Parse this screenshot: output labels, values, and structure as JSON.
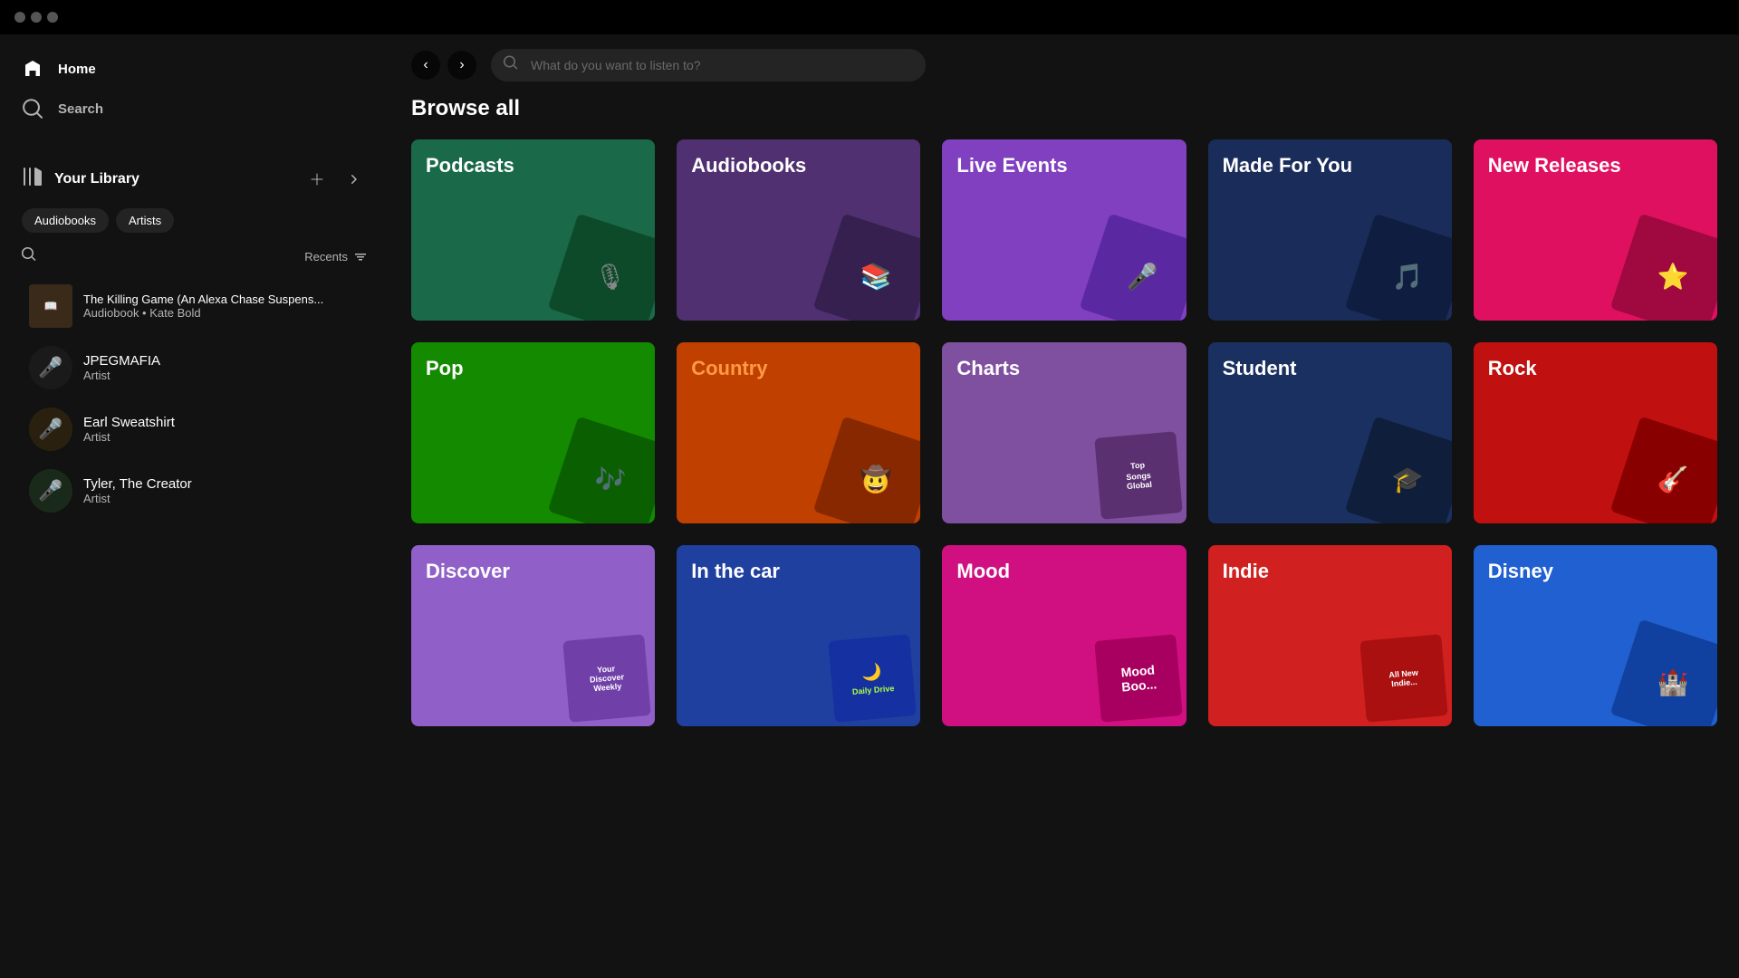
{
  "titlebar": {
    "dots": [
      "",
      "",
      ""
    ]
  },
  "sidebar": {
    "nav": [
      {
        "id": "home",
        "label": "Home",
        "icon": "⌂"
      },
      {
        "id": "search",
        "label": "Search",
        "icon": "⌕"
      }
    ],
    "library": {
      "title": "Your Library",
      "add_label": "+",
      "expand_label": "→",
      "filters": [
        "Audiobooks",
        "Artists"
      ],
      "recents_label": "Recents",
      "items": [
        {
          "id": "killing-game",
          "name": "The Killing Game (An Alexa Chase Suspens...",
          "sub": "Audiobook • Kate Bold",
          "type": "book",
          "bg": "#3a2a1a",
          "emoji": "📚"
        },
        {
          "id": "jpegmafia",
          "name": "JPEGMAFIA",
          "sub": "Artist",
          "type": "artist",
          "bg": "#2a2a2a",
          "emoji": "🎤",
          "round": true
        },
        {
          "id": "earl-sweatshirt",
          "name": "Earl Sweatshirt",
          "sub": "Artist",
          "type": "artist",
          "bg": "#2a2a2a",
          "emoji": "🎤",
          "round": true
        },
        {
          "id": "tyler-the-creator",
          "name": "Tyler, The Creator",
          "sub": "Artist",
          "type": "artist",
          "bg": "#2a2a2a",
          "emoji": "🎤",
          "round": true
        }
      ]
    }
  },
  "topbar": {
    "back": "‹",
    "forward": "›",
    "search_placeholder": "What do you want to listen to?"
  },
  "browse": {
    "title": "Browse all",
    "categories": [
      {
        "id": "podcasts",
        "label": "Podcasts",
        "bg": "bg-teal",
        "accent": "#1a6a4a"
      },
      {
        "id": "audiobooks",
        "label": "Audiobooks",
        "bg": "bg-purple-dark",
        "accent": "#503070"
      },
      {
        "id": "live-events",
        "label": "Live Events",
        "bg": "bg-purple",
        "accent": "#8040c0"
      },
      {
        "id": "made-for-you",
        "label": "Made For You",
        "bg": "bg-blue-dark",
        "accent": "#1a2d5a"
      },
      {
        "id": "new-releases",
        "label": "New Releases",
        "bg": "bg-pink",
        "accent": "#e01060"
      },
      {
        "id": "pop",
        "label": "Pop",
        "bg": "bg-green",
        "accent": "#148a00"
      },
      {
        "id": "country",
        "label": "Country",
        "bg": "bg-orange",
        "accent": "#c04000"
      },
      {
        "id": "charts",
        "label": "Charts",
        "bg": "bg-mauve",
        "accent": "#8050a0"
      },
      {
        "id": "student",
        "label": "Student",
        "bg": "bg-navy",
        "accent": "#1a3060"
      },
      {
        "id": "rock",
        "label": "Rock",
        "bg": "bg-red",
        "accent": "#c01010"
      },
      {
        "id": "discover",
        "label": "Discover",
        "bg": "bg-lavender",
        "accent": "#9060c8"
      },
      {
        "id": "in-the-car",
        "label": "In the car",
        "bg": "bg-blue",
        "accent": "#2040a0"
      },
      {
        "id": "mood",
        "label": "Mood",
        "bg": "bg-magenta",
        "accent": "#d01080"
      },
      {
        "id": "indie",
        "label": "Indie",
        "bg": "bg-red2",
        "accent": "#d02020"
      },
      {
        "id": "disney",
        "label": "Disney",
        "bg": "bg-blue2",
        "accent": "#2060d0"
      }
    ]
  }
}
